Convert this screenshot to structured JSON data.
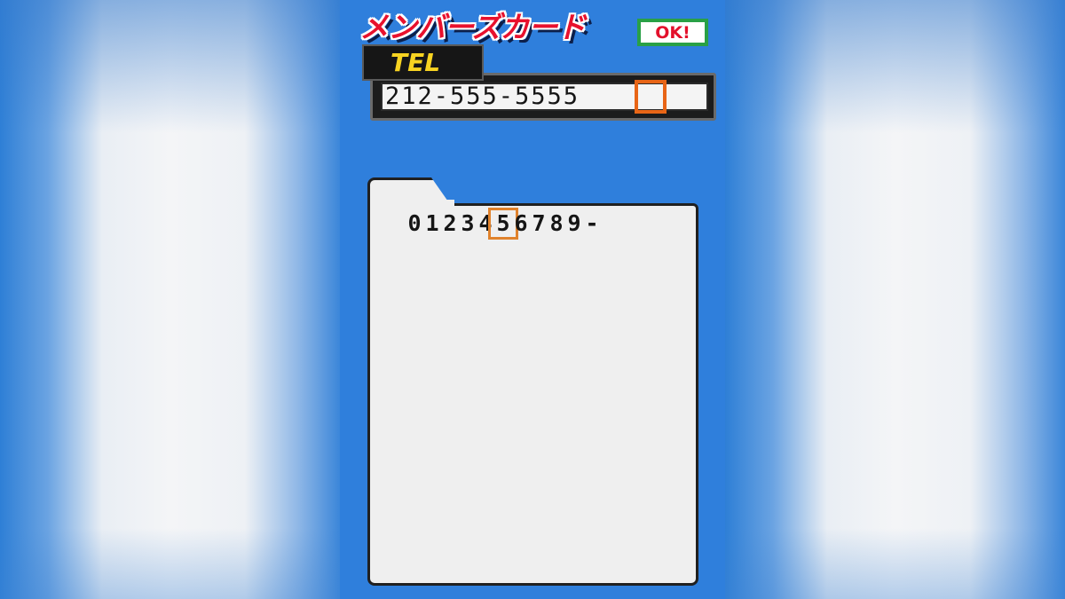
{
  "screen": {
    "title": "メンバーズカード",
    "ok_label": "OK!",
    "tel_label": "TEL",
    "tel_value": "212-555-5555",
    "keyboard": {
      "keys": [
        "0",
        "1",
        "2",
        "3",
        "4",
        "5",
        "6",
        "7",
        "8",
        "9",
        "-"
      ],
      "selected_key": "5"
    }
  },
  "colors": {
    "screen_bg": "#2f7fdc",
    "title": "#e8112d",
    "ok_border": "#29a046",
    "tel_label_text": "#f7d321",
    "cursor": "#e86516"
  }
}
